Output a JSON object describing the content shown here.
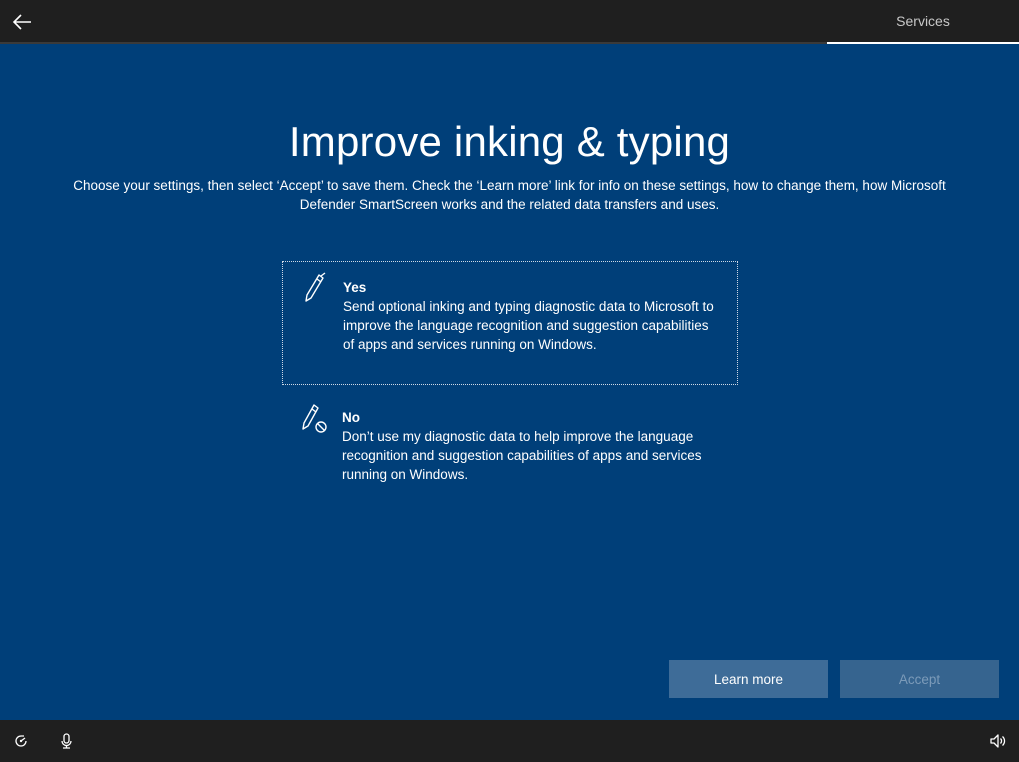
{
  "header": {
    "back_icon": "back-arrow-icon",
    "step_label": "Services"
  },
  "main": {
    "title": "Improve inking & typing",
    "subtitle": "Choose your settings, then select ‘Accept’ to save them. Check the ‘Learn more’ link for info on these settings, how to change them, how Microsoft Defender SmartScreen works and the related data transfers and uses.",
    "options": [
      {
        "icon": "pen-icon",
        "heading": "Yes",
        "description": "Send optional inking and typing diagnostic data to Microsoft to improve the language recognition and suggestion capabilities of apps and services running on Windows.",
        "selected": true
      },
      {
        "icon": "pen-blocked-icon",
        "heading": "No",
        "description": "Don’t use my diagnostic data to help improve the language recognition and suggestion capabilities of apps and services running on Windows.",
        "selected": false
      }
    ]
  },
  "buttons": {
    "learn_more": "Learn more",
    "accept": "Accept"
  },
  "footer": {
    "icons": [
      "ease-of-access-icon",
      "microphone-icon",
      "volume-icon"
    ]
  },
  "colors": {
    "background": "#003f79",
    "bars": "#1f1f1f",
    "button": "#3e6c98"
  }
}
